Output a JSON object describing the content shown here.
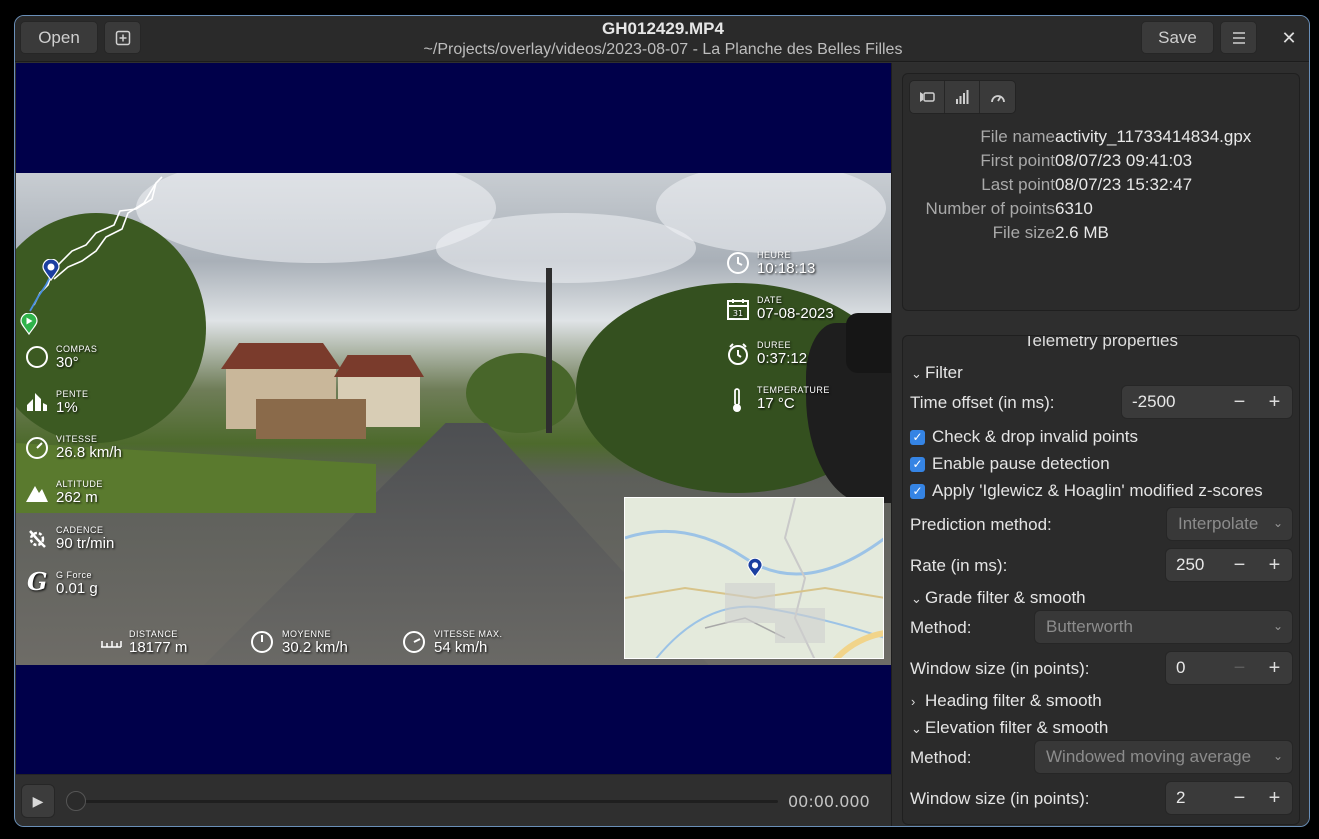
{
  "header": {
    "open_label": "Open",
    "new_icon": "plus-square-icon",
    "title": "GH012429.MP4",
    "subtitle": "~/Projects/overlay/videos/2023-08-07 - La Planche des Belles Filles",
    "save_label": "Save",
    "menu_icon": "hamburger-icon",
    "close_icon": "close-icon"
  },
  "hud": {
    "left": [
      {
        "label": "COMPAS",
        "value": "30°",
        "icon": "compass-icon"
      },
      {
        "label": "PENTE",
        "value": "1%",
        "icon": "slope-icon"
      },
      {
        "label": "VITESSE",
        "value": "26.8 km/h",
        "icon": "speedometer-icon"
      },
      {
        "label": "ALTITUDE",
        "value": "262 m",
        "icon": "mountain-icon"
      },
      {
        "label": "CADENCE",
        "value": "90 tr/min",
        "icon": "crank-icon"
      },
      {
        "label": "G Force",
        "value": "0.01 g",
        "icon": "g-force-icon"
      }
    ],
    "right": [
      {
        "label": "HEURE",
        "value": "10:18:13",
        "icon": "clock-icon"
      },
      {
        "label": "DATE",
        "value": "07-08-2023",
        "icon": "calendar-icon"
      },
      {
        "label": "DUREE",
        "value": "0:37:12",
        "icon": "timer-icon"
      },
      {
        "label": "TEMPERATURE",
        "value": "17 °C",
        "icon": "thermometer-icon"
      }
    ],
    "bottom": [
      {
        "label": "DISTANCE",
        "value": "18177 m",
        "icon": "ruler-icon"
      },
      {
        "label": "MOYENNE",
        "value": "30.2 km/h",
        "icon": "average-gauge-icon"
      },
      {
        "label": "VITESSE MAX.",
        "value": "54 km/h",
        "icon": "max-gauge-icon"
      }
    ]
  },
  "playbar": {
    "play_icon": "play-icon",
    "time": "00:00.000"
  },
  "file_info": {
    "tabs": [
      "video-icon",
      "signal-bars-icon",
      "gauge-icon"
    ],
    "rows": [
      {
        "key": "File name",
        "value": "activity_11733414834.gpx"
      },
      {
        "key": "First point",
        "value": "08/07/23 09:41:03"
      },
      {
        "key": "Last point",
        "value": "08/07/23 15:32:47"
      },
      {
        "key": "Number of points",
        "value": "6310"
      },
      {
        "key": "File size",
        "value": "2.6 MB"
      }
    ]
  },
  "telemetry": {
    "title": "Telemetry properties",
    "filter_section": "Filter",
    "time_offset_label": "Time offset (in ms):",
    "time_offset_value": "-2500",
    "check_invalid": "Check & drop invalid points",
    "check_pause": "Enable pause detection",
    "check_zscore": "Apply 'Iglewicz & Hoaglin' modified z-scores",
    "prediction_label": "Prediction method:",
    "prediction_value": "Interpolate",
    "rate_label": "Rate (in ms):",
    "rate_value": "250",
    "grade_section": "Grade filter & smooth",
    "grade_method_label": "Method:",
    "grade_method_value": "Butterworth",
    "grade_window_label": "Window size (in points):",
    "grade_window_value": "0",
    "heading_section": "Heading filter & smooth",
    "elevation_section": "Elevation filter & smooth",
    "elev_method_label": "Method:",
    "elev_method_value": "Windowed moving average",
    "elev_window_label": "Window size (in points):",
    "elev_window_value": "2",
    "minus": "−",
    "plus": "+"
  }
}
